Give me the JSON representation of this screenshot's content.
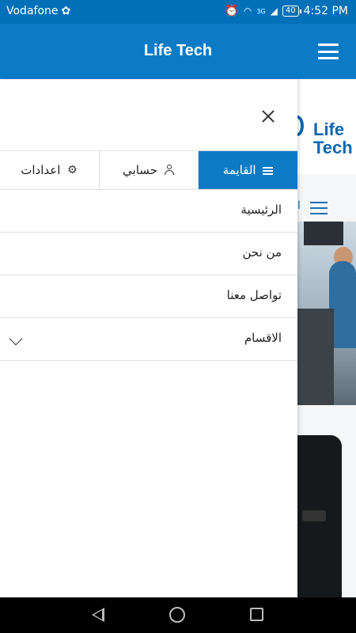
{
  "status_bar": {
    "carrier": "Vodafone",
    "network": "3G",
    "battery": "40",
    "time": "4:52 PM"
  },
  "app_bar": {
    "title": "Life Tech"
  },
  "background_page": {
    "logo_text": "Life Tech",
    "nav_partial_text": "ا"
  },
  "drawer": {
    "tabs": [
      {
        "label": "القايمة",
        "icon": "menu-lines-icon",
        "active": true
      },
      {
        "label": "حسابي",
        "icon": "user-icon",
        "active": false
      },
      {
        "label": "اعدادات",
        "icon": "gear-icon",
        "active": false
      }
    ],
    "menu_items": [
      {
        "label": "الرئيسية"
      },
      {
        "label": "من نحن"
      },
      {
        "label": "تواصل معنا"
      },
      {
        "label": "الاقسام",
        "icon": "chevron-down-icon"
      }
    ]
  },
  "colors": {
    "status_bar": "#0070b8",
    "app_bar": "#0c7bc6",
    "active_tab": "#0c7bc6"
  }
}
